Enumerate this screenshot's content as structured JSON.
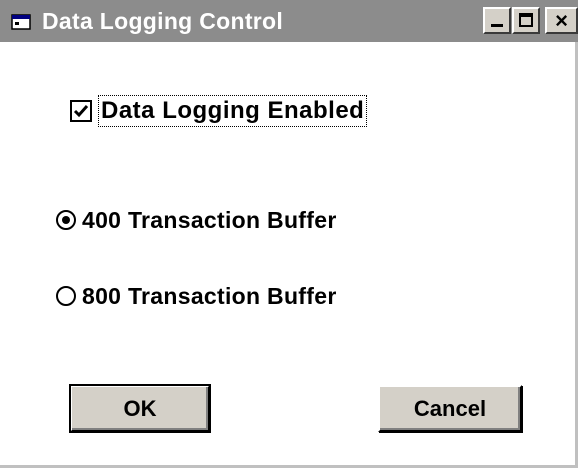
{
  "window": {
    "title": "Data Logging Control",
    "icon": "app-window-icon",
    "controls": {
      "minimize": "minimize-icon",
      "maximize": "maximize-icon",
      "close_glyph": "×"
    }
  },
  "logging": {
    "checkbox_label": "Data Logging Enabled",
    "checked": true
  },
  "buffer": {
    "options": [
      {
        "label": "400 Transaction Buffer",
        "selected": true
      },
      {
        "label": "800 Transaction Buffer",
        "selected": false
      }
    ]
  },
  "buttons": {
    "ok_label": "OK",
    "cancel_label": "Cancel"
  },
  "colors": {
    "titlebar": "#8c8c8c",
    "button_face": "#d4d0c8"
  }
}
